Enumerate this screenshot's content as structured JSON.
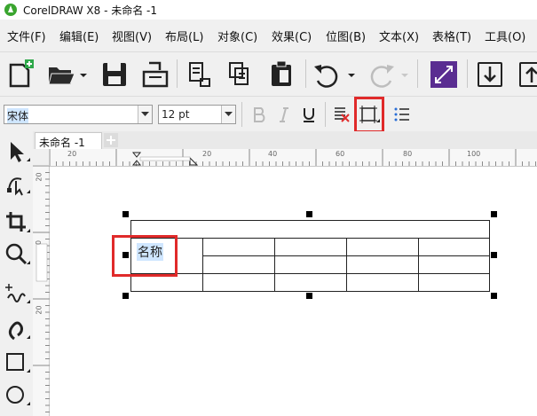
{
  "window": {
    "title": "CorelDRAW X8 - 未命名 -1"
  },
  "menu": [
    "文件(F)",
    "编辑(E)",
    "视图(V)",
    "布局(L)",
    "对象(C)",
    "效果(C)",
    "位图(B)",
    "文本(X)",
    "表格(T)",
    "工具(O)"
  ],
  "propertybar": {
    "font_name": "宋体",
    "font_size": "12 pt"
  },
  "tabs": {
    "document": "未命名 -1"
  },
  "ruler": {
    "h_labels": [
      "20",
      "20",
      "40",
      "60",
      "80",
      "100"
    ],
    "v_labels": [
      "20",
      "0",
      "20"
    ]
  },
  "table": {
    "rows": 4,
    "cols": 5,
    "cell_text": "名称"
  },
  "colors": {
    "highlight": "#e02a2a",
    "selection": "#cfe6ff",
    "active_tool": "#5a2d91"
  },
  "icons": [
    "new-document-icon",
    "open-folder-icon",
    "save-icon",
    "print-icon",
    "import-icon",
    "export-icon",
    "undo-icon",
    "redo-icon",
    "bold-icon",
    "italic-icon",
    "underline-icon",
    "text-align-icon",
    "table-border-icon",
    "bullet-list-icon",
    "pick-tool-icon",
    "shape-tool-icon",
    "crop-tool-icon",
    "zoom-tool-icon",
    "freehand-tool-icon",
    "artistic-media-icon",
    "rectangle-tool-icon",
    "ellipse-tool-icon"
  ]
}
